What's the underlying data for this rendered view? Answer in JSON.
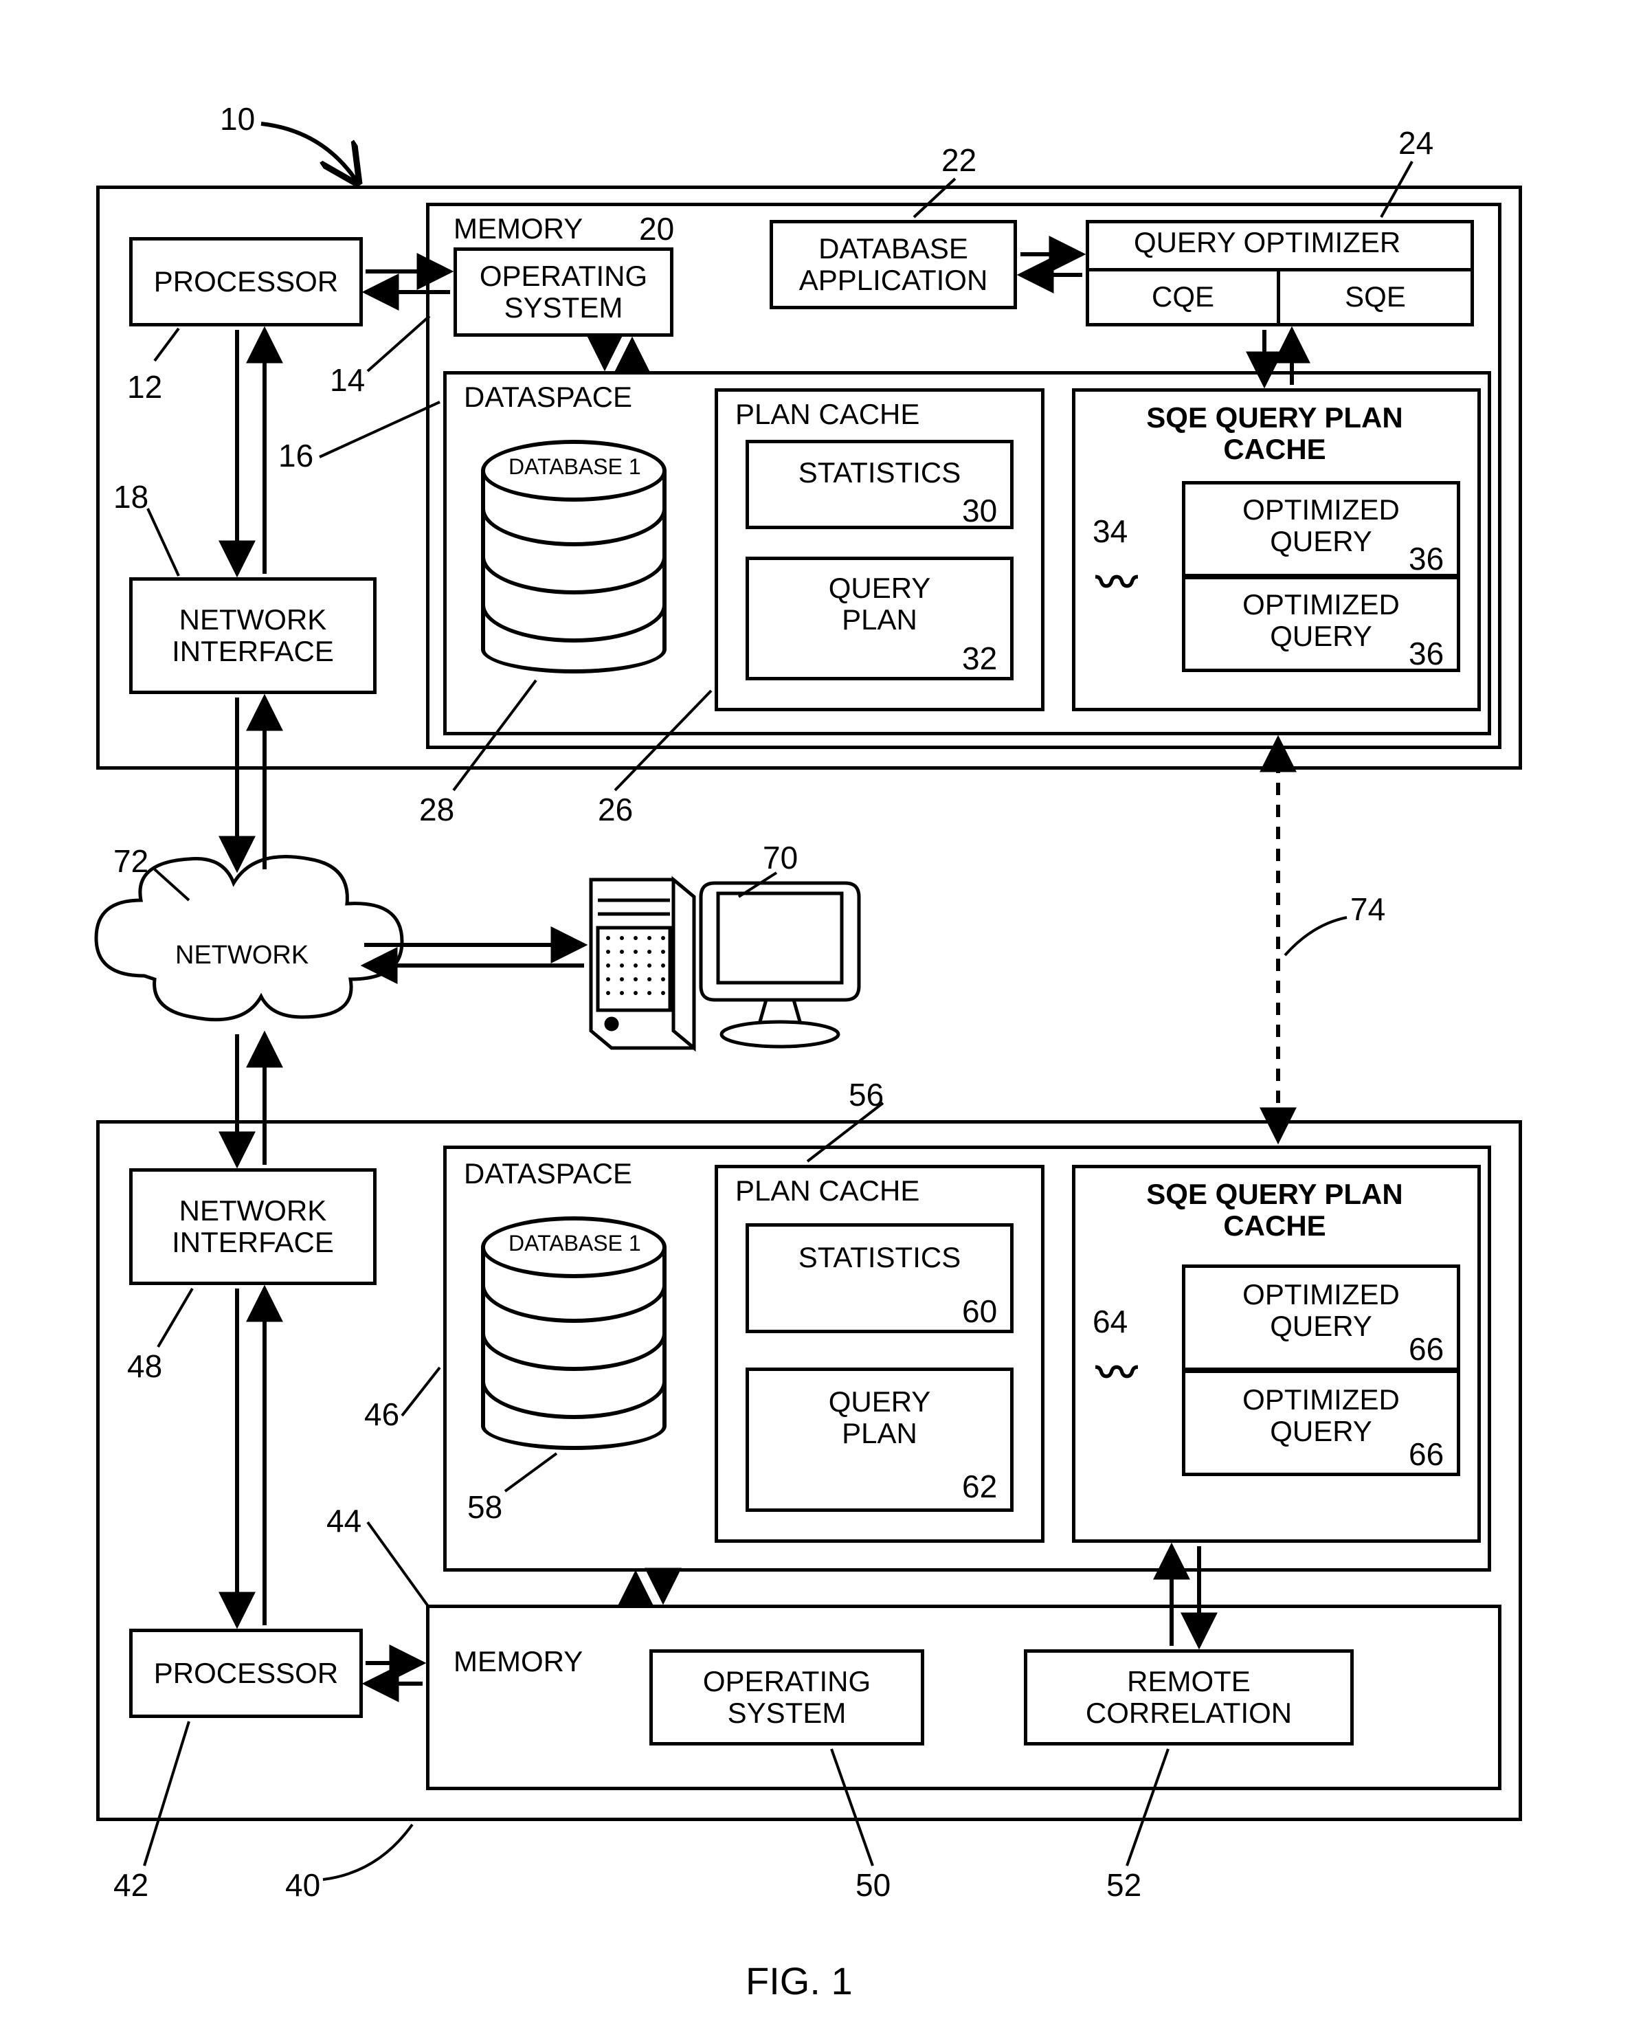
{
  "figure_label": "FIG. 1",
  "top": {
    "processor": "PROCESSOR",
    "memory_title": "MEMORY",
    "os": "OPERATING\nSYSTEM",
    "db_app": "DATABASE\nAPPLICATION",
    "qopt": "QUERY OPTIMIZER",
    "cqe": "CQE",
    "sqe": "SQE",
    "dataspace": "DATASPACE",
    "db1": "DATABASE 1",
    "plan_cache": "PLAN CACHE",
    "stats": "STATISTICS",
    "qplan": "QUERY\nPLAN",
    "sqe_cache": "SQE QUERY PLAN\nCACHE",
    "oq": "OPTIMIZED\nQUERY",
    "netif": "NETWORK\nINTERFACE"
  },
  "mid": {
    "network": "NETWORK"
  },
  "bot": {
    "netif": "NETWORK\nINTERFACE",
    "processor": "PROCESSOR",
    "memory_title": "MEMORY",
    "dataspace": "DATASPACE",
    "db1": "DATABASE 1",
    "plan_cache": "PLAN CACHE",
    "stats": "STATISTICS",
    "qplan": "QUERY\nPLAN",
    "sqe_cache": "SQE QUERY PLAN\nCACHE",
    "oq": "OPTIMIZED\nQUERY",
    "os": "OPERATING\nSYSTEM",
    "remote_corr": "REMOTE\nCORRELATION"
  },
  "refs": {
    "r10": "10",
    "r12": "12",
    "r14": "14",
    "r16": "16",
    "r18": "18",
    "r20": "20",
    "r22": "22",
    "r24": "24",
    "r26": "26",
    "r28": "28",
    "r30": "30",
    "r32": "32",
    "r34": "34",
    "r36a": "36",
    "r36b": "36",
    "r40": "40",
    "r42": "42",
    "r44": "44",
    "r46": "46",
    "r48": "48",
    "r50": "50",
    "r52": "52",
    "r56": "56",
    "r58": "58",
    "r60": "60",
    "r62": "62",
    "r64": "64",
    "r66a": "66",
    "r66b": "66",
    "r70": "70",
    "r72": "72",
    "r74": "74"
  }
}
